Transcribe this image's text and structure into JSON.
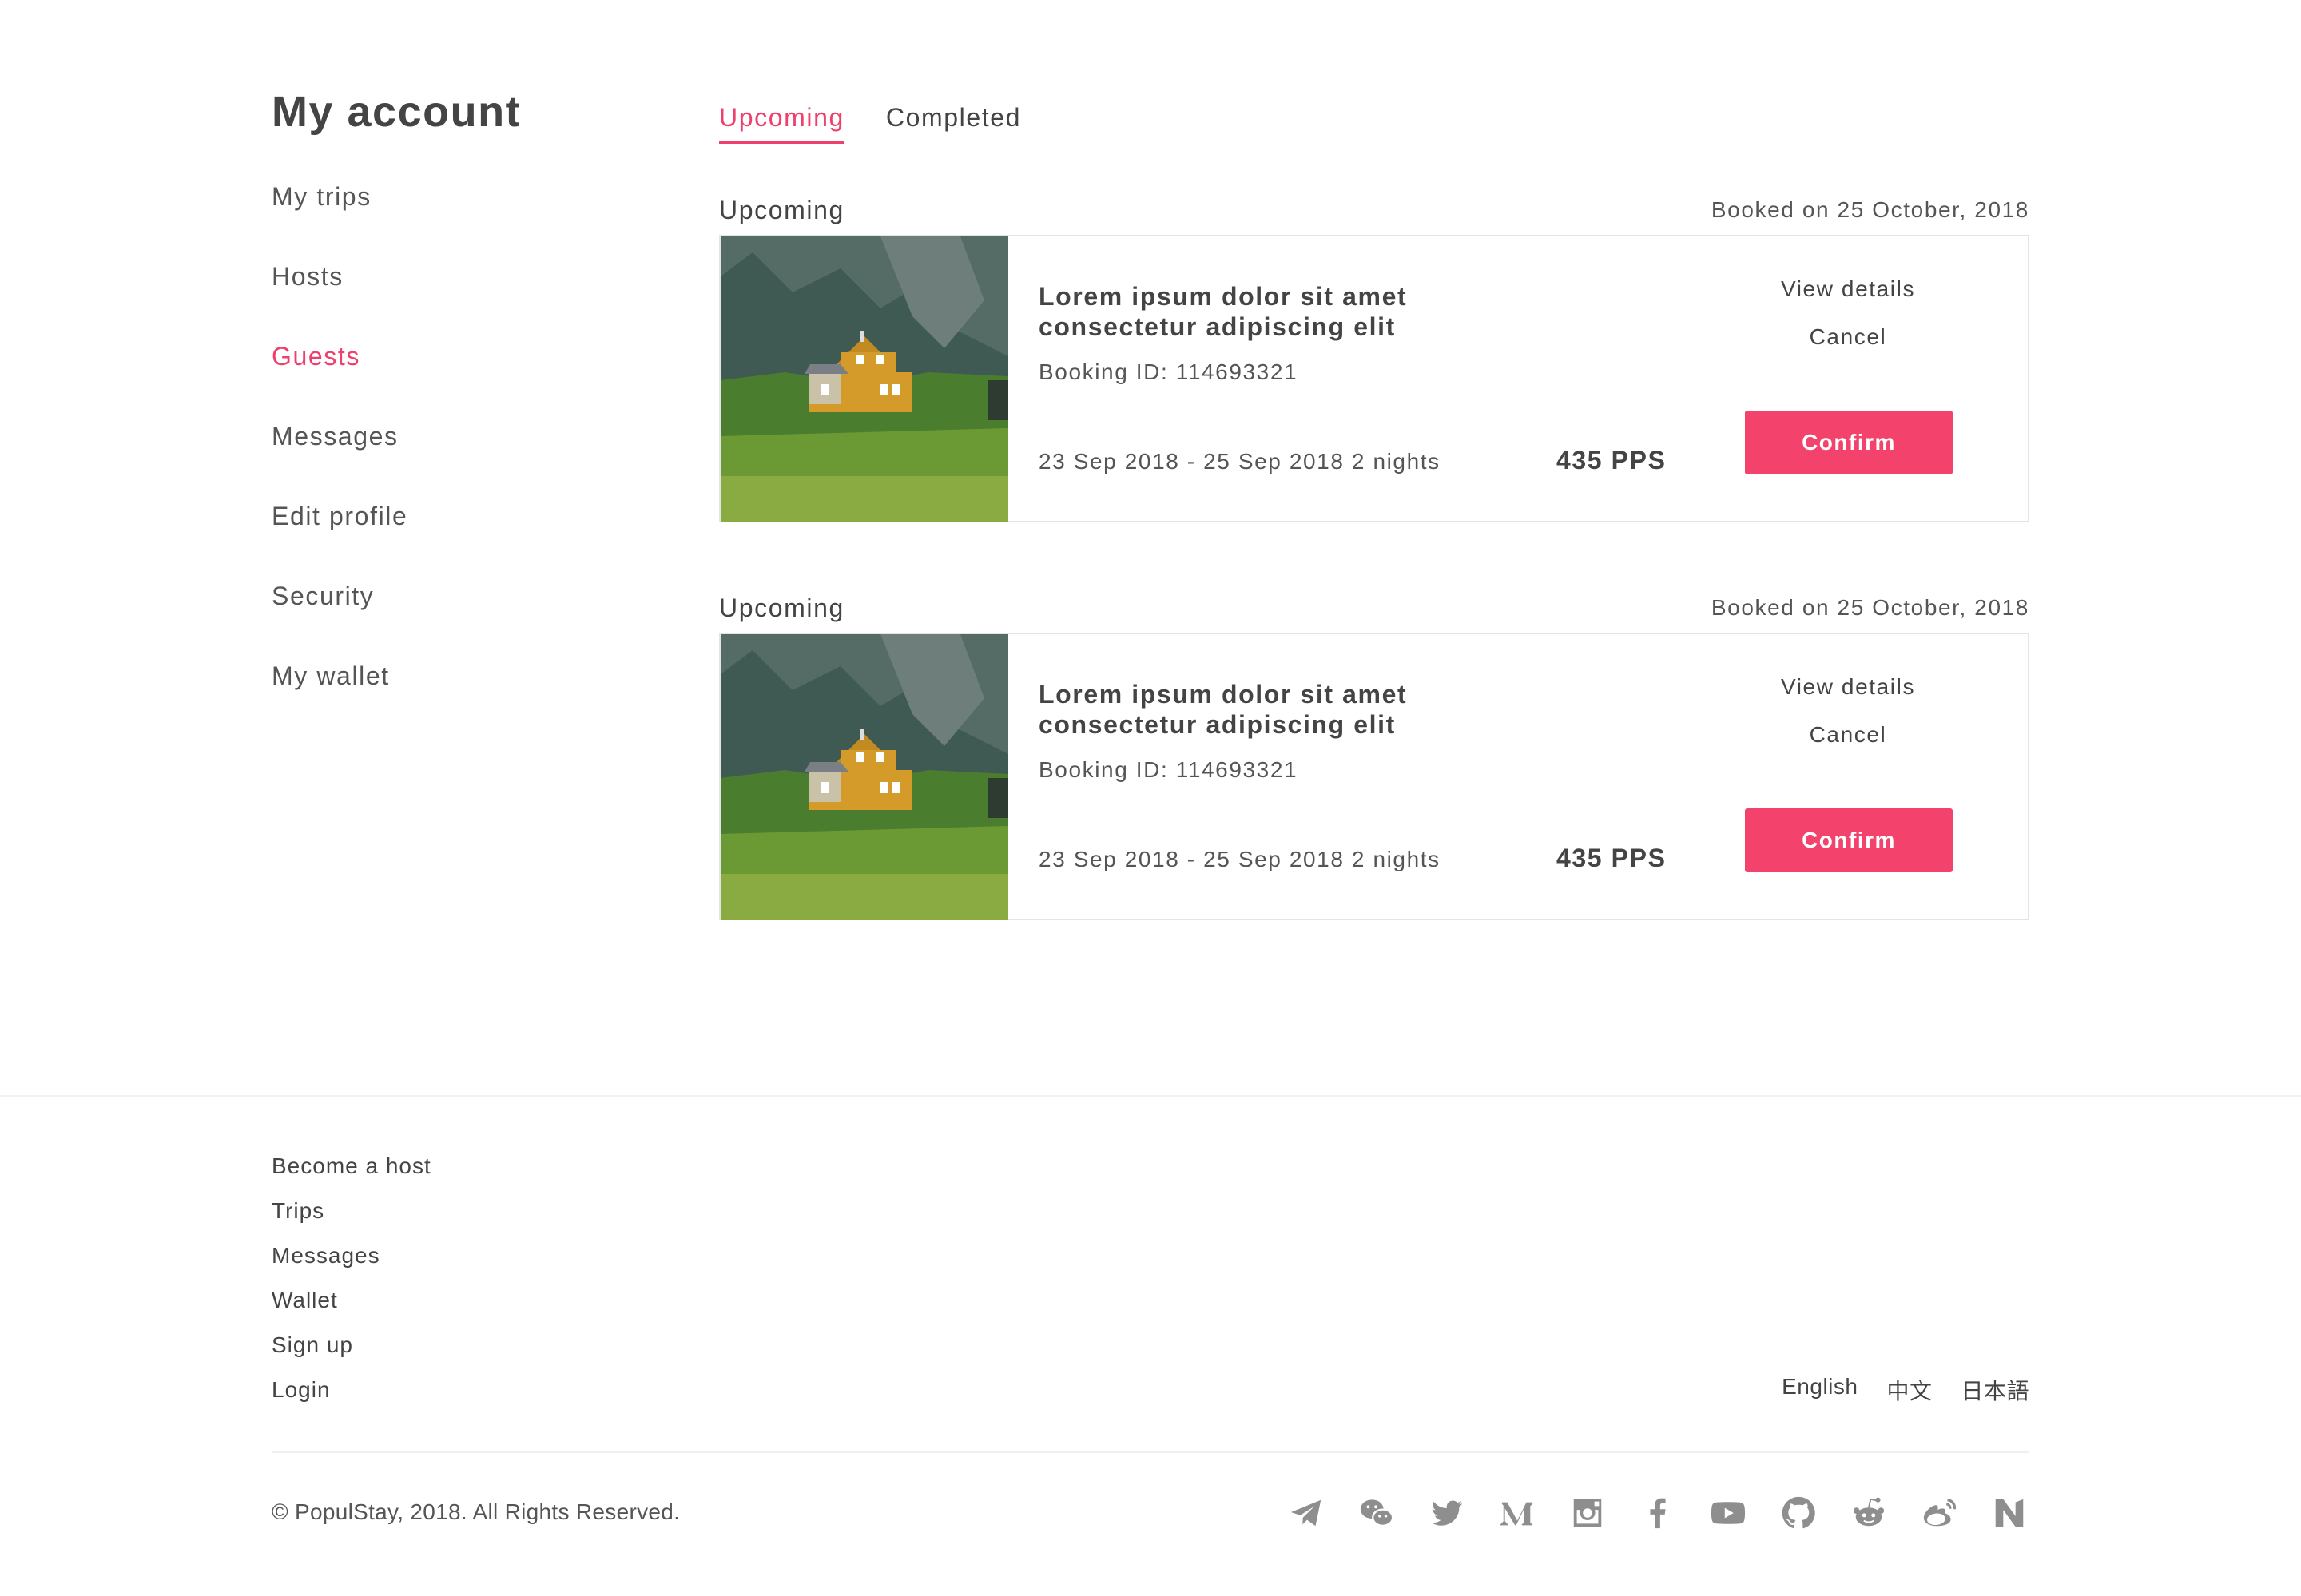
{
  "sidebar": {
    "title": "My account",
    "items": [
      {
        "label": "My trips",
        "active": false
      },
      {
        "label": "Hosts",
        "active": false
      },
      {
        "label": "Guests",
        "active": true
      },
      {
        "label": "Messages",
        "active": false
      },
      {
        "label": "Edit profile",
        "active": false
      },
      {
        "label": "Security",
        "active": false
      },
      {
        "label": "My wallet",
        "active": false
      }
    ]
  },
  "tabs": [
    {
      "label": "Upcoming",
      "active": true
    },
    {
      "label": "Completed",
      "active": false
    }
  ],
  "bookings": [
    {
      "status": "Upcoming",
      "booked_on": "Booked on 25 October, 2018",
      "title": "Lorem ipsum dolor sit amet consectetur adipiscing elit",
      "booking_id": "Booking ID: 114693321",
      "dates": "23 Sep 2018 - 25 Sep 2018  2 nights",
      "price": "435 PPS",
      "view_details": "View details",
      "cancel": "Cancel",
      "confirm": "Confirm"
    },
    {
      "status": "Upcoming",
      "booked_on": "Booked on 25 October, 2018",
      "title": "Lorem ipsum dolor sit amet consectetur adipiscing elit",
      "booking_id": "Booking ID: 114693321",
      "dates": "23 Sep 2018 - 25 Sep 2018  2 nights",
      "price": "435 PPS",
      "view_details": "View details",
      "cancel": "Cancel",
      "confirm": "Confirm"
    }
  ],
  "footer": {
    "links": [
      "Become a host",
      "Trips",
      "Messages",
      "Wallet",
      "Sign up",
      "Login"
    ],
    "languages": [
      "English",
      "中文",
      "日本語"
    ],
    "copyright": "© PopulStay, 2018. All Rights Reserved.",
    "social_icons": [
      "telegram-icon",
      "wechat-icon",
      "twitter-icon",
      "medium-icon",
      "instagram-icon",
      "facebook-icon",
      "youtube-icon",
      "github-icon",
      "reddit-icon",
      "weibo-icon",
      "neo-icon"
    ]
  },
  "colors": {
    "accent": "#ee3f6d",
    "button": "#f3426b",
    "text": "#444444",
    "icon": "#8e8e8e",
    "border": "#e4e4e4"
  }
}
